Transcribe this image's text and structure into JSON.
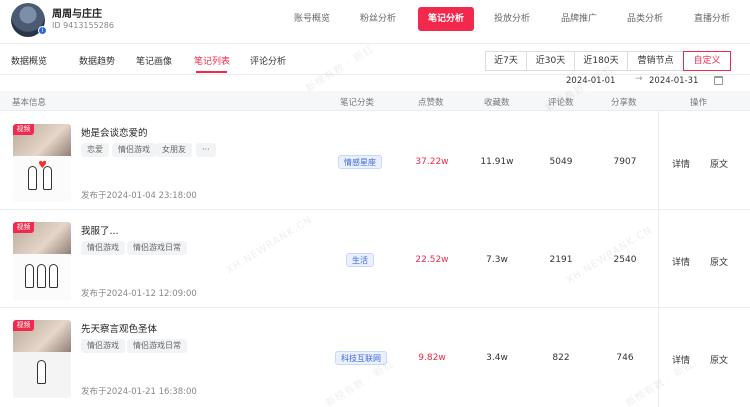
{
  "account": {
    "name": "周周与庄庄",
    "id_text": "ID 9413155286"
  },
  "nav": {
    "tabs": [
      "账号概览",
      "粉丝分析",
      "笔记分析",
      "投放分析",
      "品牌推广",
      "品类分析",
      "直播分析"
    ],
    "active": "笔记分析"
  },
  "subnav": {
    "tabs": [
      "数据概览",
      "数据趋势",
      "笔记画像",
      "笔记列表",
      "评论分析"
    ],
    "active": "笔记列表"
  },
  "range": {
    "buttons": [
      "近7天",
      "近30天",
      "近180天",
      "营销节点",
      "自定义"
    ],
    "active": "自定义",
    "start_date": "2024-01-01",
    "end_date": "2024-01-31"
  },
  "table": {
    "headers": [
      "基本信息",
      "笔记分类",
      "点赞数",
      "收藏数",
      "评论数",
      "分享数",
      "操作"
    ],
    "rows": [
      {
        "badge": "视频",
        "title": "她是会谈恋爱的",
        "tags": [
          "恋爱",
          "情侣游戏",
          "女朋友",
          "···"
        ],
        "published": "发布于2024-01-04 23:18:00",
        "category": "情感星座",
        "likes": "37.22w",
        "favorites": "11.91w",
        "comments": "5049",
        "shares": "7907",
        "ops": [
          "详情",
          "原文"
        ]
      },
      {
        "badge": "视频",
        "title": "我服了...",
        "tags": [
          "情侣游戏",
          "情侣游戏日常"
        ],
        "published": "发布于2024-01-12 12:09:00",
        "category": "生活",
        "likes": "22.52w",
        "favorites": "7.3w",
        "comments": "2191",
        "shares": "2540",
        "ops": [
          "详情",
          "原文"
        ]
      },
      {
        "badge": "视频",
        "title": "先天察言观色圣体",
        "tags": [
          "情侣游戏",
          "情侣游戏日常"
        ],
        "published": "发布于2024-01-21 16:38:00",
        "category": "科技互联网",
        "likes": "9.82w",
        "favorites": "3.4w",
        "comments": "822",
        "shares": "746",
        "ops": [
          "详情",
          "原文"
        ]
      }
    ]
  },
  "watermark": "新榜有数 · 新红",
  "watermark_url": "XH.NEWRANK.CN",
  "colors": {
    "accent": "#f2294c",
    "category_blue": "#3d6bd9"
  }
}
